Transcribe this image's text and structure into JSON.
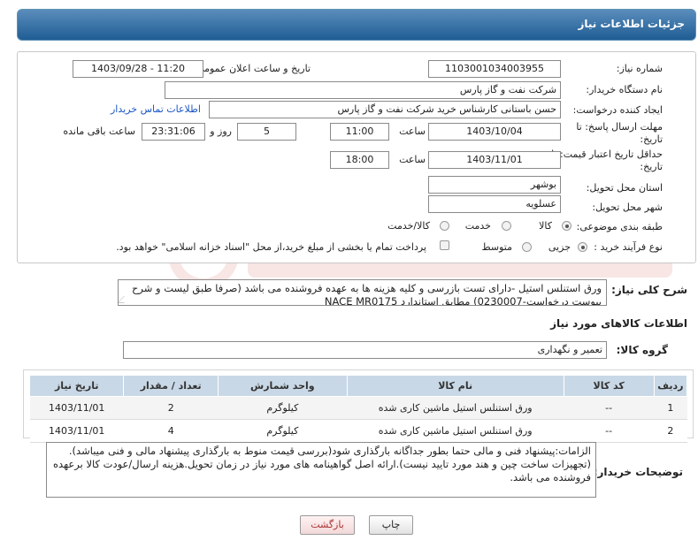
{
  "header": {
    "title": "جزئیات اطلاعات نیاز"
  },
  "form": {
    "need_number_label": "شماره نیاز:",
    "need_number": "1103001034003955",
    "announce_label": "تاریخ و ساعت اعلان عمومی:",
    "announce_value": "1403/09/28 - 11:20",
    "buyer_org_label": "نام دستگاه خریدار:",
    "buyer_org": "شرکت نفت و گاز پارس",
    "requester_label": "ایجاد کننده درخواست:",
    "requester": "حسن باستانی کارشناس خرید شرکت نفت و گاز پارس",
    "buyer_contact_link": "اطلاعات تماس خریدار",
    "deadline_label_line1": "مهلت ارسال پاسخ: تا",
    "deadline_label_line2": "تاریخ:",
    "deadline_date": "1403/10/04",
    "time_label": "ساعت",
    "deadline_time": "11:00",
    "days_value": "5",
    "days_label": "روز و",
    "remaining_time": "23:31:06",
    "remaining_label": "ساعت باقی مانده",
    "validity_label_line1": "حداقل تاریخ اعتبار قیمت: تا",
    "validity_label_line2": "تاریخ:",
    "validity_date": "1403/11/01",
    "validity_time_label": "ساعت",
    "validity_time": "18:00",
    "province_label": "استان محل تحویل:",
    "province": "بوشهر",
    "city_label": "شهر محل تحویل:",
    "city": "عسلویه",
    "category_label": "طبقه بندی موضوعی:",
    "category_options": [
      "کالا",
      "خدمت",
      "کالا/خدمت"
    ],
    "category_selected": "کالا",
    "process_label": "نوع فرآیند خرید :",
    "process_options": [
      "جزیی",
      "متوسط"
    ],
    "process_selected": "جزیی",
    "payment_note": "پرداخت تمام یا بخشی از مبلغ خرید،از محل \"اسناد خزانه اسلامی\" خواهد بود."
  },
  "description": {
    "label": "شرح کلی نیاز:",
    "text": "ورق استنلس استیل -دارای تست بازرسی و کلیه هزینه ها به عهده فروشنده می باشد (صرفا طبق لیست و شرح پیوست درخواست-0230007) مطابق استاندارد NACE MR0175"
  },
  "goods": {
    "section_title": "اطلاعات کالاهای مورد نیاز",
    "group_label": "گروه کالا:",
    "group_value": "تعمیر و نگهداری",
    "columns": [
      "ردیف",
      "کد کالا",
      "نام کالا",
      "واحد شمارش",
      "تعداد / مقدار",
      "تاریخ نیاز"
    ],
    "rows": [
      {
        "idx": "1",
        "code": "--",
        "name": "ورق استنلس استیل ماشین کاری شده",
        "unit": "کیلوگرم",
        "qty": "2",
        "date": "1403/11/01"
      },
      {
        "idx": "2",
        "code": "--",
        "name": "ورق استنلس استیل ماشین کاری شده",
        "unit": "کیلوگرم",
        "qty": "4",
        "date": "1403/11/01"
      }
    ]
  },
  "buyer_notes": {
    "label": "توضیحات خریدار:",
    "text": "الزامات:پیشنهاد فنی و مالی حتما  بطور جداگانه بارگذاری شود(بررسی قیمت منوط به بارگذاری پیشنهاد مالی و فنی میباشد).(تجهیزات ساخت چین و هند مورد تایید نیست).ارائه اصل گواهینامه های مورد نیاز در زمان تحویل.هزینه ارسال/عودت کالا برعهده فروشنده می باشد."
  },
  "buttons": {
    "print": "چاپ",
    "back": "بازگشت"
  },
  "colors": {
    "header_bg": "#1f5d94",
    "table_header_bg": "#c9d8e6",
    "link": "#1a55c5"
  }
}
